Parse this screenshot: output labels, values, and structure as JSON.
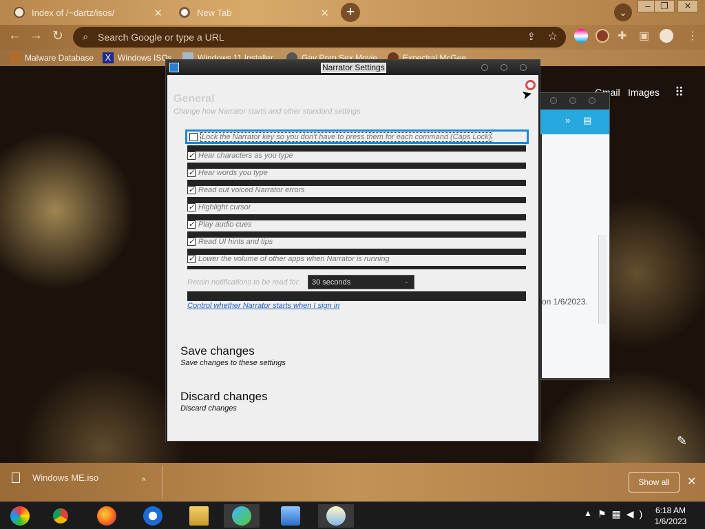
{
  "browser": {
    "tabs": [
      {
        "title": "Index of /~dartz/isos/"
      },
      {
        "title": "New Tab"
      }
    ],
    "omnibox_placeholder": "Search Google or type a URL",
    "bookmarks": [
      "Malware Database",
      "Windows ISOs",
      "Windows 11 Installer",
      "Gay Porn Sex Movie",
      "Expectral McGee"
    ],
    "google_links": {
      "gmail": "Gmail",
      "images": "Images"
    }
  },
  "narrator": {
    "window_title": "Narrator Settings",
    "section_title": "General",
    "section_subtitle": "Change how Narrator starts and other standard settings",
    "options": [
      {
        "label": "Lock the Narrator key so you don't have to press them for each command (Caps Lock)",
        "checked": false
      },
      {
        "label": "Hear characters as you type",
        "checked": true
      },
      {
        "label": "Hear words you type",
        "checked": true
      },
      {
        "label": "Read out voiced Narrator errors",
        "checked": true
      },
      {
        "label": "Highlight cursor",
        "checked": true
      },
      {
        "label": "Play audio cues",
        "checked": true
      },
      {
        "label": "Read UI hints and tips",
        "checked": true
      },
      {
        "label": "Lower the volume of other apps when Narrator is running",
        "checked": true
      }
    ],
    "retain_label": "Retain notifications to be read for:",
    "retain_value": "30 seconds",
    "signin_link": "Control whether Narrator starts when I sign in",
    "save_title": "Save changes",
    "save_desc": "Save changes to these settings",
    "discard_title": "Discard changes",
    "discard_desc": "Discard changes"
  },
  "background_window": {
    "date_text": "on 1/6/2023."
  },
  "downloads": {
    "file": "Windows ME.iso",
    "show_all": "Show all"
  },
  "taskbar": {
    "time": "6:18 AM",
    "date": "1/6/2023"
  },
  "colors": {
    "focus_ring": "#1b89d8",
    "link": "#1f5fc8"
  }
}
